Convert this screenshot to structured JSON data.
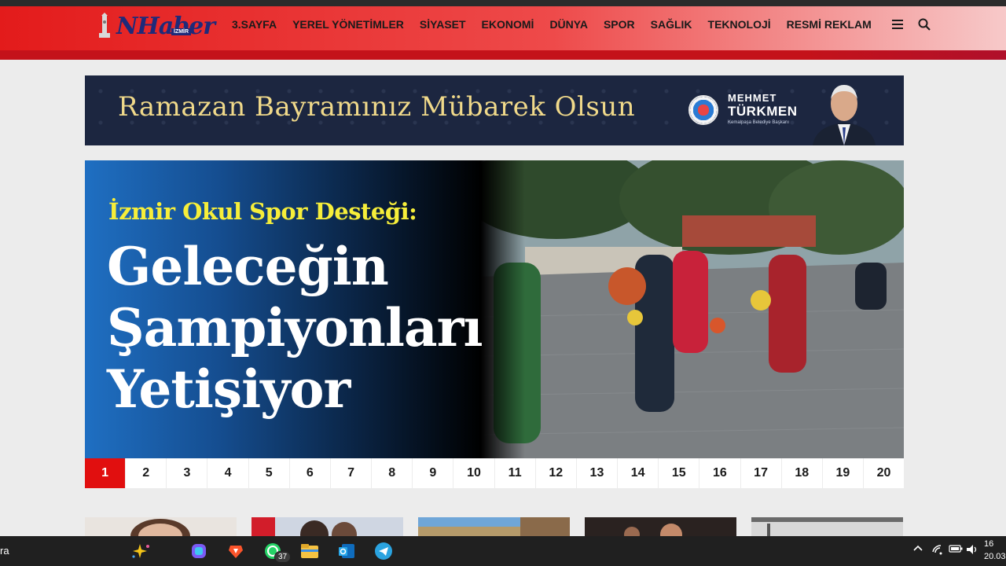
{
  "header": {
    "logo_text": "NHaber",
    "logo_tag": "İZMİR",
    "nav": [
      {
        "label": "3.SAYFA"
      },
      {
        "label": "YEREL YÖNETİMLER"
      },
      {
        "label": "SİYASET"
      },
      {
        "label": "EKONOMİ"
      },
      {
        "label": "DÜNYA"
      },
      {
        "label": "SPOR"
      },
      {
        "label": "SAĞLIK"
      },
      {
        "label": "TEKNOLOJİ"
      },
      {
        "label": "RESMİ REKLAM"
      }
    ],
    "icons": [
      "menu-icon",
      "search-icon"
    ]
  },
  "banner": {
    "text": "Ramazan Bayramınız Mübarek Olsun",
    "name_first": "MEHMET",
    "name_last": "TÜRKMEN",
    "name_title": "Kemalpaşa Belediye Başkanı"
  },
  "slider": {
    "kicker": "İzmir Okul Spor Desteği:",
    "title_lines": [
      "Geleceğin",
      "Şampiyonları",
      "Yetişiyor"
    ],
    "pages": [
      "1",
      "2",
      "3",
      "4",
      "5",
      "6",
      "7",
      "8",
      "9",
      "10",
      "11",
      "12",
      "13",
      "14",
      "15",
      "16",
      "17",
      "18",
      "19",
      "20"
    ],
    "active_page": "1"
  },
  "taskbar": {
    "left_text": "ra",
    "whatsapp_badge": "37",
    "clock_time": "16",
    "clock_date": "20.03",
    "icons": [
      "copilot-sparkle-icon",
      "copilot-icon",
      "brave-icon",
      "whatsapp-icon",
      "file-explorer-icon",
      "outlook-icon",
      "telegram-icon",
      "chevron-up-icon",
      "wifi-icon",
      "battery-icon",
      "volume-icon"
    ]
  },
  "colors": {
    "header_red": "#e31b1b",
    "active_page": "#e10f0f",
    "kicker_yellow": "#f6ee3a",
    "banner_bg": "#1c2640",
    "banner_text": "#f0d98a"
  }
}
